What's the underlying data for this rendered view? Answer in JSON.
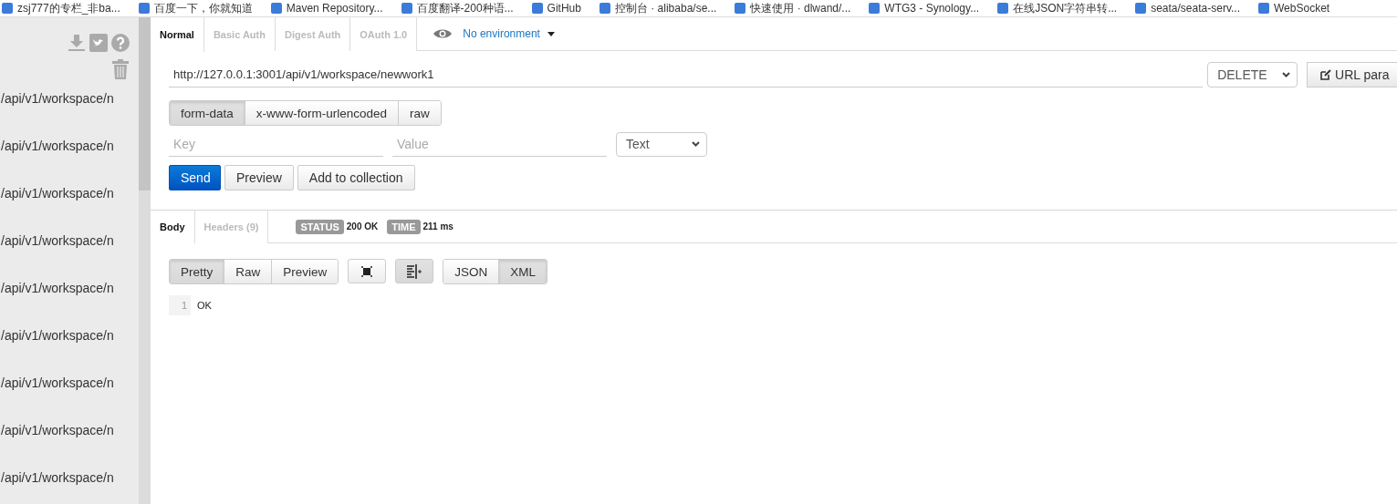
{
  "bookmarks": [
    {
      "label": "zsj777的专栏_非ba..."
    },
    {
      "label": "百度一下，你就知道"
    },
    {
      "label": "Maven Repository..."
    },
    {
      "label": "百度翻译-200种语..."
    },
    {
      "label": "GitHub"
    },
    {
      "label": "控制台 · alibaba/se..."
    },
    {
      "label": "快速使用 · dlwand/..."
    },
    {
      "label": "WTG3 - Synology..."
    },
    {
      "label": "在线JSON字符串转..."
    },
    {
      "label": "seata/seata-serv..."
    },
    {
      "label": "WebSocket"
    }
  ],
  "sidebar": {
    "items": [
      "/api/v1/workspace/n",
      "/api/v1/workspace/n",
      "/api/v1/workspace/n",
      "/api/v1/workspace/n",
      "/api/v1/workspace/n",
      "/api/v1/workspace/n",
      "/api/v1/workspace/n",
      "/api/v1/workspace/n",
      "/api/v1/workspace/n"
    ]
  },
  "auth_tabs": [
    {
      "label": "Normal",
      "selected": true
    },
    {
      "label": "Basic Auth",
      "selected": false
    },
    {
      "label": "Digest Auth",
      "selected": false
    },
    {
      "label": "OAuth 1.0",
      "selected": false
    }
  ],
  "environment": {
    "label": "No environment"
  },
  "request": {
    "url": "http://127.0.0.1:3001/api/v1/workspace/newwork1",
    "method": "DELETE",
    "url_params_button": "URL para"
  },
  "body_types": [
    {
      "label": "form-data",
      "selected": true
    },
    {
      "label": "x-www-form-urlencoded",
      "selected": false
    },
    {
      "label": "raw",
      "selected": false
    }
  ],
  "params": {
    "key_placeholder": "Key",
    "value_placeholder": "Value",
    "type": "Text"
  },
  "actions": [
    {
      "label": "Send",
      "kind": "primary"
    },
    {
      "label": "Preview",
      "kind": "default"
    },
    {
      "label": "Add to collection",
      "kind": "default"
    }
  ],
  "response": {
    "tabs": [
      {
        "label": "Body",
        "selected": true
      },
      {
        "label": "Headers (9)",
        "selected": false
      }
    ],
    "status_label": "STATUS",
    "status": "200 OK",
    "time_label": "TIME",
    "time": "211 ms",
    "view_modes": [
      {
        "label": "Pretty",
        "selected": true
      },
      {
        "label": "Raw",
        "selected": false
      },
      {
        "label": "Preview",
        "selected": false
      }
    ],
    "toggles": [
      {
        "kind": "fullscreen",
        "selected": false
      },
      {
        "kind": "wrap",
        "selected": true
      }
    ],
    "formats": [
      {
        "label": "JSON",
        "selected": false
      },
      {
        "label": "XML",
        "selected": true
      }
    ],
    "lines": [
      {
        "number": "1",
        "text": "OK"
      }
    ]
  }
}
